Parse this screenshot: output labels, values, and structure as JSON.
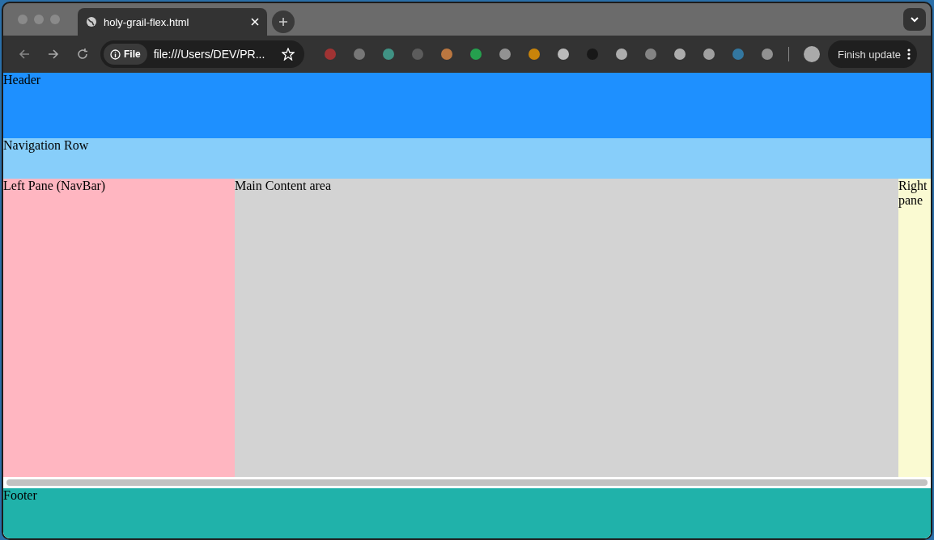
{
  "browser": {
    "tab": {
      "title": "holy-grail-flex.html",
      "selected": true
    },
    "address": {
      "chip": "File",
      "url": "file:///Users/DEV/PR..."
    },
    "update_button": "Finish update"
  },
  "page": {
    "header": "Header",
    "navigation": "Navigation Row",
    "left_pane": "Left Pane (NavBar)",
    "main": "Main Content area",
    "right_pane": "Right pane",
    "footer": "Footer"
  }
}
